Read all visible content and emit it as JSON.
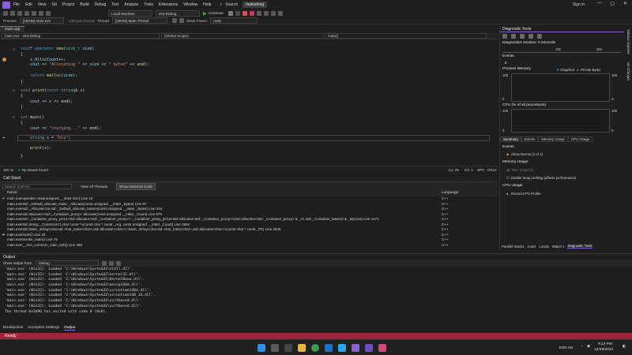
{
  "menu": {
    "items": [
      "File",
      "Edit",
      "View",
      "Git",
      "Project",
      "Build",
      "Debug",
      "Test",
      "Analyze",
      "Tools",
      "Extensions",
      "Window",
      "Help"
    ],
    "search": "Search",
    "solution": "fastestring",
    "signin": "Sign in",
    "win_min": "—",
    "win_max": "▢",
    "win_close": "✕"
  },
  "toolbar": {
    "machine": "Local Machine",
    "config": "x64-Debug",
    "continue": "Continue",
    "continue_icon": "▶"
  },
  "locbar": {
    "process_label": "Process:",
    "process": "[15048] main.exe",
    "lifecycle": "Lifecycle Events",
    "thread_label": "Thread:",
    "thread": "[15048] Main Thread",
    "stack_label": "Stack Frame:",
    "stack": "main"
  },
  "editor": {
    "tab": "main.cpp",
    "nav_scope": "main.exe - x64-Debug",
    "nav_global": "(Global Scope)",
    "nav_fn": "main()",
    "lines": [
      [
        "void* operator new(size_t size)"
      ],
      [
        "{"
      ],
      [
        "    s_AllocCount++;"
      ],
      [
        "    cout << \"Allocating \" << size << \" bytes\" << endl;"
      ],
      [
        ""
      ],
      [
        "    return malloc(size);"
      ],
      [
        "}"
      ],
      [
        ""
      ],
      [
        "void print(const string& s)"
      ],
      [
        "{"
      ],
      [
        "    cout << s << endl;"
      ],
      [
        "}"
      ],
      [
        ""
      ],
      [
        ""
      ],
      [
        "int main()"
      ],
      [
        "{"
      ],
      [
        "    cout << \"starging...\" << endl;"
      ],
      [
        ""
      ],
      [
        "    string s = \"bla\";"
      ],
      [
        ""
      ],
      [
        "    print(s);"
      ],
      [
        ""
      ],
      [
        "}"
      ]
    ],
    "zoom": "100 %",
    "issues": "No issues found",
    "ln": "Ln: 25",
    "ch": "Ch: 1",
    "spc": "SPC",
    "crlf": "CRLF"
  },
  "callstack": {
    "title": "Call Stack",
    "search_placeholder": "Search (Ctrl+E)",
    "view_all_threads": "View All Threads",
    "show_external": "Show External Code",
    "col_name": "Name",
    "col_lang": "Language",
    "rows": [
      {
        "name": "main.exe!operator new(unsigned __int64 size) Line 10",
        "lang": "C++"
      },
      {
        "name": "main.exe!std::_Default_allocate_traits::_Allocate(const unsigned __int64 _Bytes) Line 87",
        "lang": "C++"
      },
      {
        "name": "main.exe!std::_Allocate<16,std::_Default_allocate_traits>(const unsigned __int64 _Bytes) Line 244",
        "lang": "C++"
      },
      {
        "name": "main.exe!std::allocator<std::_Container_proxy>::allocate(const unsigned __int64 _Count) Line 979",
        "lang": "C++"
      },
      {
        "name": "main.exe!std::_Container_proxy_ptr12<std::allocator<std::_Container_proxy>>::_Container_proxy_ptr12<std::allocator<std::_Container_proxy>>(std::allocator<std::_Container_proxy> & _Al, std::_Container_base12 & _Mycont) Line 1471",
        "lang": "C++"
      },
      {
        "name": "main.exe!std::string::_Construct<1,char const *>(const char * const _Arg, const unsigned __int64 _Count) Line 2652",
        "lang": "C++"
      },
      {
        "name": "main.exe!std::basic_string<char,std::char_traits<char>,std::allocator<char>>::basic_string<char,std::char_traits<char>,std::allocator<char>>(const char * const _Ptr) Line 2546",
        "lang": "C++"
      },
      {
        "name": "main.exe!main() Line 25",
        "lang": "C++"
      },
      {
        "name": "main.exe!invoke_main() Line 79",
        "lang": "C++"
      },
      {
        "name": "main.exe!__scrt_common_main_seh() Line 288",
        "lang": "C++"
      }
    ]
  },
  "output": {
    "title": "Output",
    "show_from_label": "Show output from:",
    "source": "Debug",
    "lines": [
      "'main.exe' (Win32): Loaded 'C:\\Windows\\System32\\ntdll.dll'.",
      "'main.exe' (Win32): Loaded 'C:\\Windows\\System32\\kernel32.dll'.",
      "'main.exe' (Win32): Loaded 'C:\\Windows\\System32\\KernelBase.dll'.",
      "'main.exe' (Win32): Loaded 'C:\\Windows\\System32\\msvcp140d.dll'.",
      "'main.exe' (Win32): Loaded 'C:\\Windows\\System32\\vcruntime140d.dll'.",
      "'main.exe' (Win32): Loaded 'C:\\Windows\\System32\\vcruntime140_1d.dll'.",
      "'main.exe' (Win32): Loaded 'C:\\Windows\\System32\\ucrtbased.dll'.",
      "'main.exe' (Win32): Loaded 'C:\\Windows\\System32\\ucrtbased.dll'.",
      "The thread 0x2b90 has exited with code 0 (0x0)."
    ]
  },
  "bottom_tabs": [
    "Breakpoints",
    "Exception Settings",
    "Output"
  ],
  "status": {
    "text": "Ready"
  },
  "diag": {
    "title": "Diagnostic Tools",
    "session": "Diagnostics session: 0 seconds",
    "t10": "10s",
    "t20": "20s",
    "events": "Events",
    "pause": "II",
    "process_memory": "Process Memory",
    "snapshot": "Snapshot",
    "private_bytes": "Private Bytes",
    "mem_max": "100",
    "mem_min": "0",
    "cpu": "CPU (% of all processors)",
    "cpu_max": "100",
    "cpu_min": "0",
    "tabs": [
      "Summary",
      "Events",
      "Memory Usage",
      "CPU Usage"
    ],
    "sum_events": "Events",
    "show_events": "Show Events (1 of 1)",
    "mem_usage": "Memory Usage",
    "take_snapshot": "Take Snapshot",
    "enable_heap": "Enable heap profiling (affects performance)",
    "cpu_usage": "CPU Usage",
    "record_cpu": "Record CPU Profile",
    "bottom_tabs": [
      "Parallel Stacks",
      "Autos",
      "Locals",
      "Watch 1",
      "Diagnostic Tools"
    ]
  },
  "side": {
    "a": "Solution Explorer",
    "b": "Git Changes"
  },
  "taskbar": {
    "lang": "ENG\nUS",
    "time": "9:13 PM",
    "date": "12/29/2023"
  },
  "colors": {
    "accent": "#8a63d2",
    "status_bar": "#a1243b",
    "breakpoint": "#e08a3a"
  }
}
